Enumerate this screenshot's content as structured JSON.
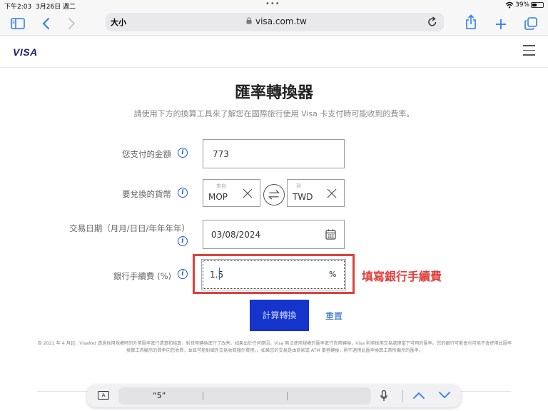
{
  "status_bar": {
    "time": "下午2:03",
    "date": "3月26日 週二",
    "battery": "39%"
  },
  "browser": {
    "text_size_button": "大小",
    "url": "visa.com.tw",
    "icons": [
      "sidebar-icon",
      "back-icon",
      "forward-icon",
      "lock-icon",
      "reload-icon",
      "share-icon",
      "new-tab-icon",
      "tabs-icon"
    ]
  },
  "site": {
    "logo": "VISA"
  },
  "converter": {
    "title": "匯率轉換器",
    "subtitle": "請使用下方的換算工具來了解您在國際旅行使用 Visa 卡支付時可能收到的費率。",
    "amount_label": "您支付的金額",
    "amount_value": "773",
    "currency_label": "要兌換的貨幣",
    "from_caption": "來自",
    "from_currency": "MOP",
    "to_caption": "到",
    "to_currency": "TWD",
    "date_label": "交易日期（月月/日日/年年年年）",
    "date_value": "03/08/2024",
    "fee_label": "銀行手續費 (%)",
    "fee_value": "1.5",
    "fee_unit": "%",
    "annotation": "填寫銀行手續費",
    "submit_label": "計算轉換",
    "reset_label": "重置",
    "info_icon_glyph": "i",
    "disclaimer": "自 2021 年 4 月起，VisaNet 透過採用規權時的外幣匯率進行清算和結算，對貨幣轉換進行了改善。如果出於任何原因，Visa 無法使用規權的匯率進行貨幣轉換，Visa 則將採用交易處理當下可用的匯率。您的銀行可能會也可能不會使用此匯率換算工具顯示的費率向您收費，並且可能對國外交易收取額外費用。。如果您的交易是由商家或 ATM 業者轉換，則不適用此匯率換算工具所顯示的匯率。"
  },
  "keyboard_bar": {
    "kb_icon_label": "A",
    "suggestion": "“5”"
  },
  "colors": {
    "visa_blue": "#1a1f71",
    "button_blue": "#1434cb",
    "annotation_red": "#e0403c",
    "link_blue": "#1a5ec8",
    "safari_blue": "#2f7cf6"
  }
}
